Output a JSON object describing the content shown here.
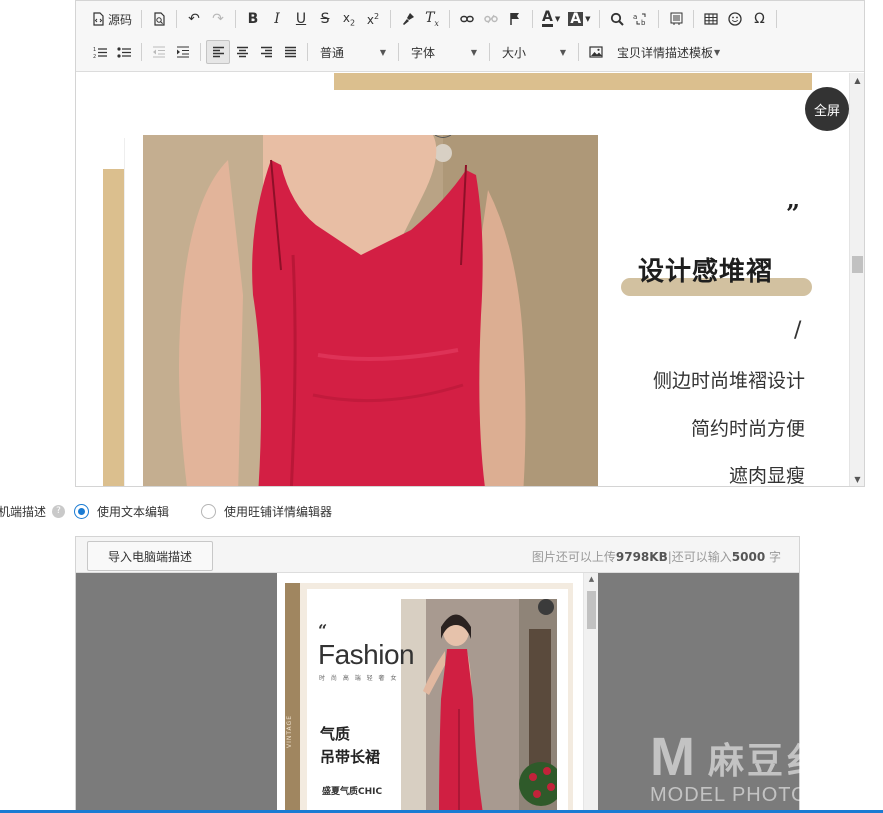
{
  "toolbar": {
    "source_label": "源码",
    "paragraph_select": "普通",
    "font_select": "字体",
    "size_select": "大小",
    "template_menu": "宝贝详情描述模板",
    "text_color_glyph": "A",
    "bg_color_glyph": "A",
    "omega_glyph": "Ω"
  },
  "editor": {
    "fullscreen_label": "全屏",
    "poster": {
      "quote": "”",
      "headline": "设计感堆褶",
      "slash": "/",
      "feature_1": "侧边时尚堆褶设计",
      "feature_2": "简约时尚方便",
      "feature_3": "遮肉显瘦",
      "accent_color": "#dbbf8e",
      "dress_color": "#d41f45"
    }
  },
  "mobile_desc": {
    "label": "机端描述",
    "options": [
      {
        "label": "使用文本编辑",
        "selected": true
      },
      {
        "label": "使用旺铺详情编辑器",
        "selected": false
      }
    ]
  },
  "panel": {
    "import_button": "导入电脑端描述",
    "quota_prefix": "图片还可以上传",
    "quota_kb": "9798KB",
    "quota_mid": "|还可以输入",
    "quota_chars": "5000",
    "quota_suffix": " 字",
    "poster": {
      "quote": "“",
      "title": "Fashion",
      "subtitle": "时 尚 高 端 轻 奢 女",
      "line_1": "气质",
      "line_2": "吊带长裙",
      "line_3": "盛夏气质CHIC",
      "vertical_text": "VINTAGE"
    }
  },
  "watermark": {
    "logo": "M",
    "cn": "麻豆纟",
    "en": "MODEL PHOTO"
  }
}
